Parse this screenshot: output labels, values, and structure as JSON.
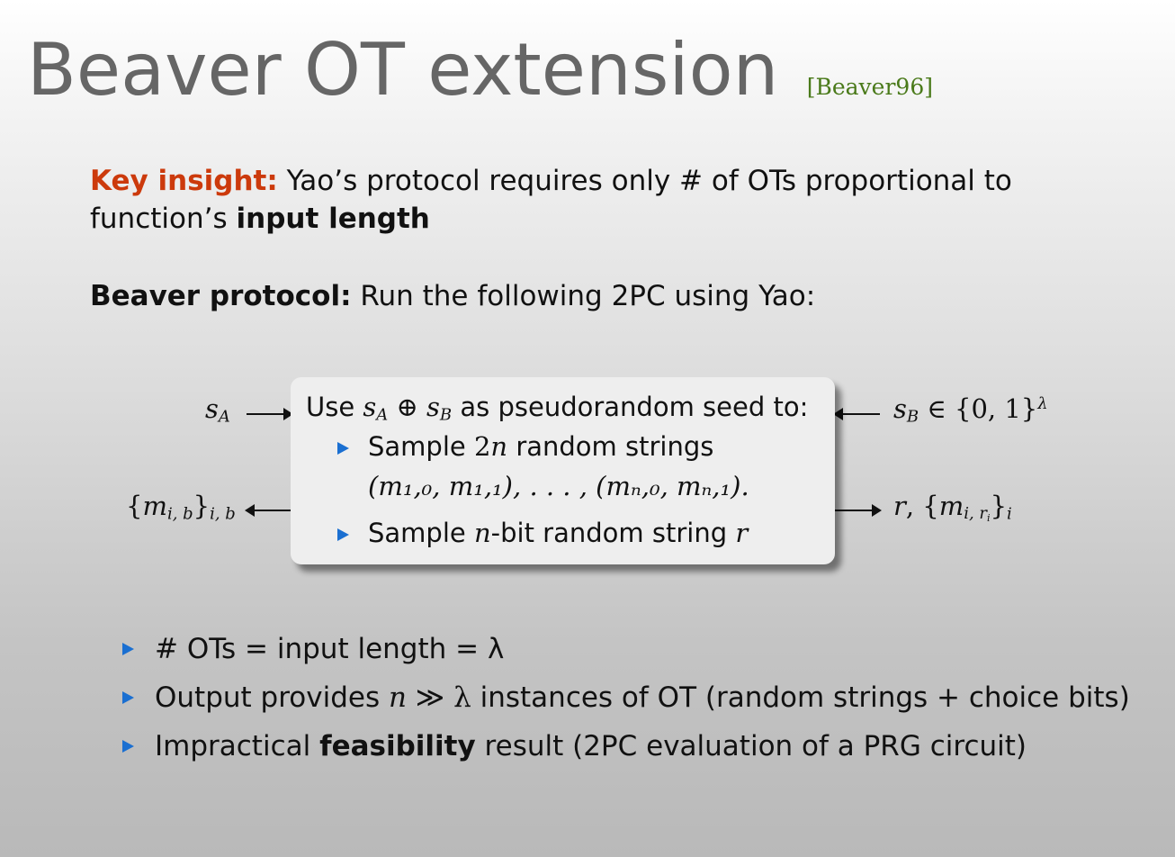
{
  "title": {
    "main": "Beaver OT extension",
    "citation": "[Beaver96]"
  },
  "insight": {
    "label": "Key insight:",
    "text_1": " Yao’s protocol requires only # of OTs proportional to function’s ",
    "bold": "input length"
  },
  "protocol": {
    "label": "Beaver protocol:",
    "text": " Run the following 2PC using Yao:"
  },
  "diagram": {
    "left_input": {
      "var": "s",
      "sub": "A"
    },
    "right_input": {
      "var": "s",
      "sub": "B",
      "rel": " ∈ {0, 1}",
      "sup": "λ"
    },
    "left_output": {
      "open": "{",
      "var": "m",
      "sub1": "i, b",
      "close": "}",
      "sub2": "i, b"
    },
    "right_output": {
      "var": "r",
      "sep": ", {",
      "var2": "m",
      "sub1": "i, r",
      "subsub": "i",
      "close": "}",
      "sub2": "i"
    },
    "box": {
      "heading_pre": "Use ",
      "heading_v1": "s",
      "heading_s1": "A",
      "heading_op": " ⊕ ",
      "heading_v2": "s",
      "heading_s2": "B",
      "heading_post": " as pseudorandom seed to:",
      "bullet1_a": "Sample ",
      "bullet1_num": "2",
      "bullet1_n": "n",
      "bullet1_b": " random strings",
      "bullet1_math": "(m₁,₀, m₁,₁), . . . , (mₙ,₀, mₙ,₁).",
      "bullet2_a": "Sample ",
      "bullet2_n": "n",
      "bullet2_b": "-bit random string ",
      "bullet2_r": "r"
    }
  },
  "bullets": {
    "b1": "# OTs = input length = λ",
    "b2_a": "Output provides ",
    "b2_n": "n",
    "b2_rel": " ≫ λ",
    "b2_b": " instances of OT (random strings + choice bits)",
    "b3_a": "Impractical ",
    "b3_bold": "feasibility",
    "b3_b": " result (2PC evaluation of a PRG circuit)"
  },
  "colors": {
    "title": "#666666",
    "citation": "#4a7a1a",
    "accent": "#cc3a0c",
    "bullet": "#1a6fd1"
  }
}
